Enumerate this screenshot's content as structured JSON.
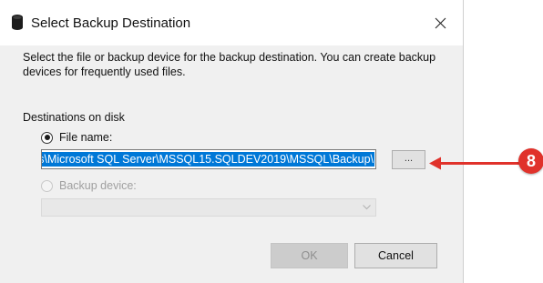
{
  "window": {
    "title": "Select Backup Destination",
    "close_icon": "close-icon",
    "title_icon": "database-icon"
  },
  "dialog": {
    "description": "Select the file or backup device for the backup destination. You can create backup devices for frequently used files.",
    "section_label": "Destinations on disk",
    "file_name": {
      "label": "File name:",
      "selected": true,
      "value": "s\\Microsoft SQL Server\\MSSQL15.SQLDEV2019\\MSSQL\\Backup\\"
    },
    "browse_button": "...",
    "backup_device": {
      "label": "Backup device:",
      "selected": false,
      "enabled": false,
      "value": ""
    },
    "ok_button": "OK",
    "cancel_button": "Cancel"
  },
  "annotation": {
    "step_number": "8",
    "color": "#e0322b"
  },
  "colors": {
    "selection": "#0078d7",
    "dialog_bg": "#f0f0f0"
  }
}
